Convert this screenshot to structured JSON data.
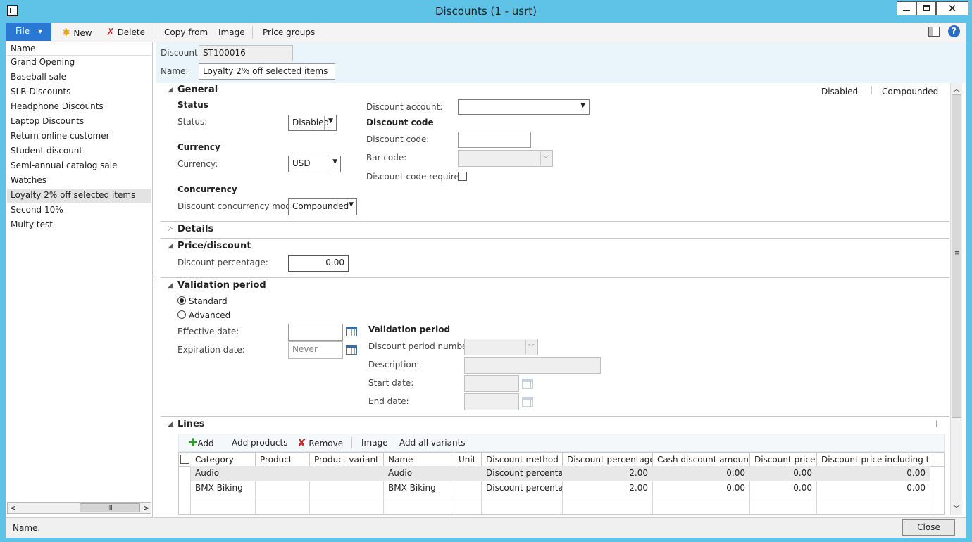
{
  "window": {
    "title": "Discounts (1 - usrt)"
  },
  "toolbar": {
    "file": "File",
    "new": "New",
    "delete": "Delete",
    "copy_from": "Copy from",
    "image": "Image",
    "price_groups": "Price groups"
  },
  "list": {
    "header": "Name",
    "items": [
      "Grand Opening",
      "Baseball sale",
      "SLR Discounts",
      "Headphone Discounts",
      "Laptop Discounts",
      "Return online customer",
      "Student discount",
      "Semi-annual catalog sale",
      "Watches",
      "Loyalty 2% off selected items",
      "Second 10%",
      "Multy test"
    ],
    "selected_index": 9
  },
  "header": {
    "discount_label": "Discount:",
    "discount_value": "ST100016",
    "name_label": "Name:",
    "name_value": "Loyalty 2% off selected items"
  },
  "general": {
    "title": "General",
    "summary_status": "Disabled",
    "summary_concurrency": "Compounded",
    "status_heading": "Status",
    "status_label": "Status:",
    "status_value": "Disabled",
    "currency_heading": "Currency",
    "currency_label": "Currency:",
    "currency_value": "USD",
    "concurrency_heading": "Concurrency",
    "concurrency_label": "Discount concurrency mode:",
    "concurrency_value": "Compounded",
    "discount_account_label": "Discount account:",
    "discount_account_value": "",
    "discount_code_heading": "Discount code",
    "discount_code_label": "Discount code:",
    "discount_code_value": "",
    "bar_code_label": "Bar code:",
    "bar_code_value": "",
    "code_required_label": "Discount code required:",
    "code_required_checked": false
  },
  "details": {
    "title": "Details"
  },
  "price_discount": {
    "title": "Price/discount",
    "pct_label": "Discount percentage:",
    "pct_value": "0.00"
  },
  "validation": {
    "title": "Validation period",
    "standard_label": "Standard",
    "advanced_label": "Advanced",
    "selected": "Standard",
    "effective_label": "Effective date:",
    "effective_value": "",
    "expiration_label": "Expiration date:",
    "expiration_value": "Never",
    "sub_heading": "Validation period",
    "period_number_label": "Discount period number:",
    "description_label": "Description:",
    "start_label": "Start date:",
    "end_label": "End date:"
  },
  "lines": {
    "title": "Lines",
    "toolbar": {
      "add": "Add",
      "add_products": "Add products",
      "remove": "Remove",
      "image": "Image",
      "add_all_variants": "Add all variants"
    },
    "columns": [
      "Category",
      "Product",
      "Product variant",
      "Name",
      "Unit",
      "Discount method",
      "Discount percentage",
      "Cash discount amount",
      "Discount price",
      "Discount price including tax"
    ],
    "rows": [
      [
        "Audio",
        "",
        "",
        "Audio",
        "",
        "Discount percentage",
        "2.00",
        "0.00",
        "0.00",
        "0.00"
      ],
      [
        "BMX Biking",
        "",
        "",
        "BMX Biking",
        "",
        "Discount percentage",
        "2.00",
        "0.00",
        "0.00",
        "0.00"
      ]
    ]
  },
  "status_bar": {
    "text": "Name.",
    "close": "Close"
  },
  "colors": {
    "title_bar": "#5fc3e8",
    "file_button": "#2b78d4",
    "selected_row": "#e3e3e3",
    "header_band": "#eaf4fb"
  }
}
